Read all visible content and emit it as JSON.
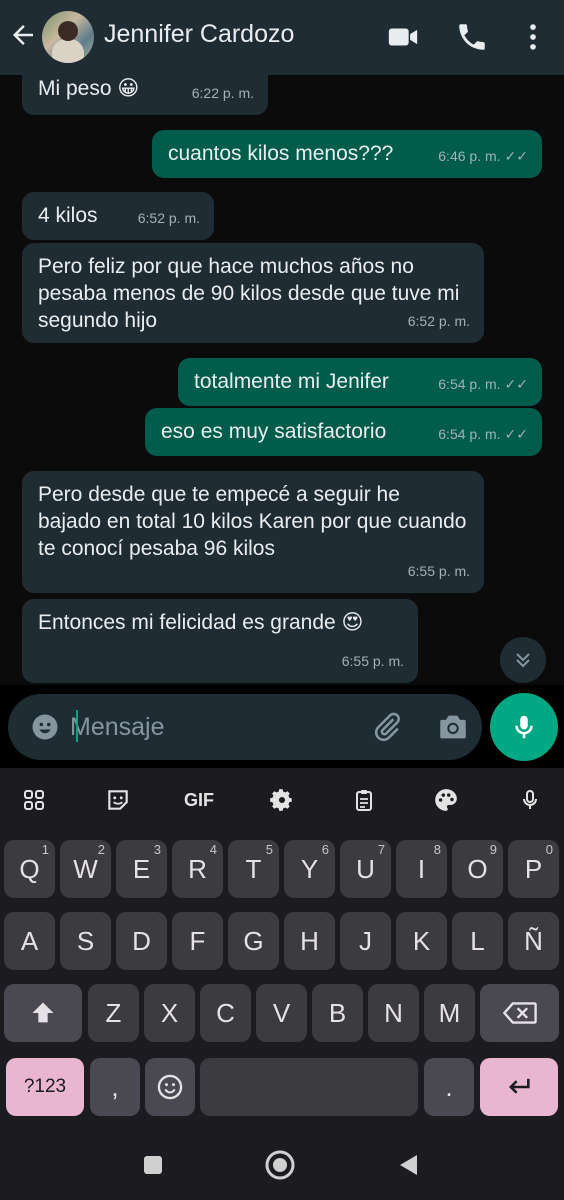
{
  "header": {
    "contact_name": "Jennifer Cardozo",
    "icons": [
      "back-arrow-icon",
      "video-call-icon",
      "phone-call-icon",
      "more-options-icon"
    ]
  },
  "messages": [
    {
      "direction": "in",
      "text": "Mi peso 😀",
      "time": "6:22 p. m."
    },
    {
      "direction": "out",
      "text": "cuantos kilos menos???",
      "time": "6:46 p. m.",
      "status": "read"
    },
    {
      "direction": "in",
      "text": "4 kilos",
      "time": "6:52 p. m."
    },
    {
      "direction": "in",
      "text": "Pero feliz por que hace muchos años no pesaba menos de 90 kilos desde que tuve mi segundo hijo",
      "time": "6:52 p. m."
    },
    {
      "direction": "out",
      "text": "totalmente mi Jenifer",
      "time": "6:54 p. m.",
      "status": "read"
    },
    {
      "direction": "out",
      "text": "eso es muy satisfactorio",
      "time": "6:54 p. m.",
      "status": "read"
    },
    {
      "direction": "in",
      "text": "Pero desde que te empecé a seguir he bajado en total 10 kilos Karen por que cuando te conocí pesaba 96 kilos",
      "time": "6:55 p. m."
    },
    {
      "direction": "in",
      "text": "Entonces mi felicidad es grande 😍",
      "time": "6:55 p. m."
    }
  ],
  "ticks": "✓✓",
  "composer": {
    "placeholder": "Mensaje"
  },
  "keyboard": {
    "toolbar": {
      "gif_label": "GIF"
    },
    "row1": [
      {
        "label": "Q",
        "hint": "1"
      },
      {
        "label": "W",
        "hint": "2"
      },
      {
        "label": "E",
        "hint": "3"
      },
      {
        "label": "R",
        "hint": "4"
      },
      {
        "label": "T",
        "hint": "5"
      },
      {
        "label": "Y",
        "hint": "6"
      },
      {
        "label": "U",
        "hint": "7"
      },
      {
        "label": "I",
        "hint": "8"
      },
      {
        "label": "O",
        "hint": "9"
      },
      {
        "label": "P",
        "hint": "0"
      }
    ],
    "row2": [
      "A",
      "S",
      "D",
      "F",
      "G",
      "H",
      "J",
      "K",
      "L",
      "Ñ"
    ],
    "row3": [
      "Z",
      "X",
      "C",
      "V",
      "B",
      "N",
      "M"
    ],
    "symbols_label": "?123",
    "comma_label": ",",
    "period_label": "."
  },
  "colors": {
    "header_bg": "#1f2c34",
    "incoming_bubble": "#1f2c34",
    "outgoing_bubble": "#005c4b",
    "accent": "#00a884",
    "keyboard_bg": "#1c1b1f",
    "key_bg": "#3c3b40",
    "enter_key": "#e8b6d0"
  }
}
